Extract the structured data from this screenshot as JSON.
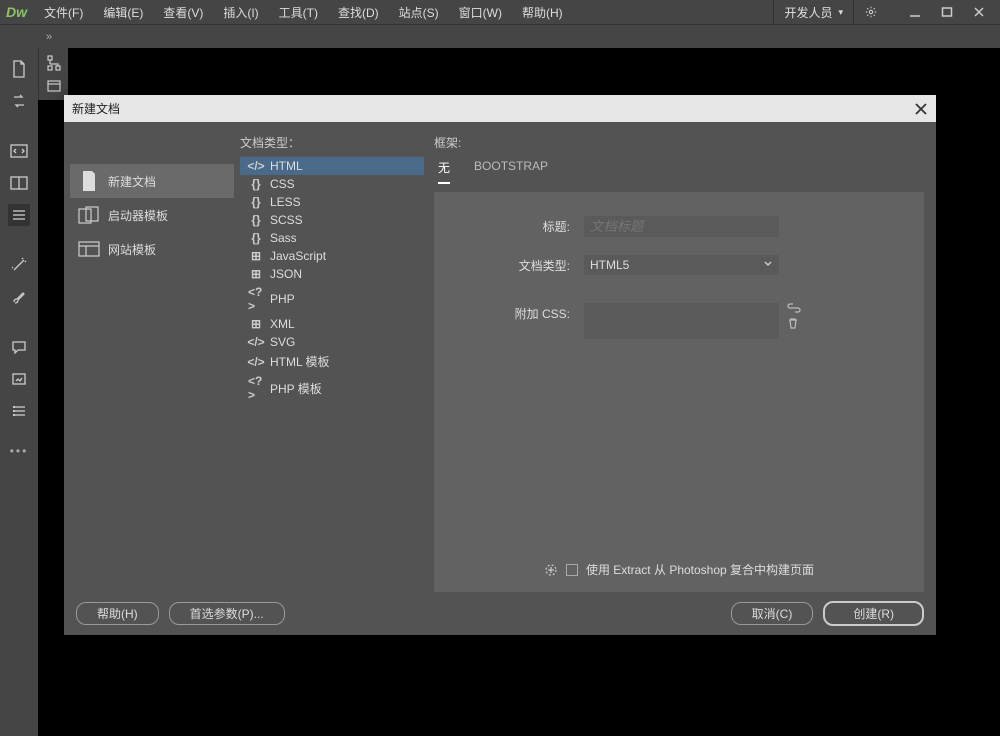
{
  "app": {
    "logo": "Dw"
  },
  "menu": [
    "文件(F)",
    "编辑(E)",
    "查看(V)",
    "插入(I)",
    "工具(T)",
    "查找(D)",
    "站点(S)",
    "窗口(W)",
    "帮助(H)"
  ],
  "workspace": {
    "label": "开发人员",
    "has_dropdown": true
  },
  "tabstrip": {
    "marker": "»"
  },
  "dialog": {
    "title": "新建文档",
    "categories": [
      {
        "icon": "file",
        "label": "新建文档",
        "selected": true
      },
      {
        "icon": "starter",
        "label": "启动器模板",
        "selected": false
      },
      {
        "icon": "sitetpl",
        "label": "网站模板",
        "selected": false
      }
    ],
    "types_header": "文档类型：",
    "types": [
      {
        "icon": "</>",
        "label": "HTML",
        "selected": true
      },
      {
        "icon": "{}",
        "label": "CSS"
      },
      {
        "icon": "{}",
        "label": "LESS"
      },
      {
        "icon": "{}",
        "label": "SCSS"
      },
      {
        "icon": "{}",
        "label": "Sass"
      },
      {
        "icon": "⊞",
        "label": "JavaScript"
      },
      {
        "icon": "⊞",
        "label": "JSON"
      },
      {
        "icon": "<?>",
        "label": "PHP"
      },
      {
        "icon": "⊞",
        "label": "XML"
      },
      {
        "icon": "</>",
        "label": "SVG"
      },
      {
        "icon": "</>",
        "label": "HTML 模板"
      },
      {
        "icon": "<?>",
        "label": "PHP 模板"
      }
    ],
    "frame_header": "框架:",
    "frame_tabs": [
      {
        "label": "无",
        "selected": true
      },
      {
        "label": "BOOTSTRAP",
        "selected": false
      }
    ],
    "form": {
      "title_label": "标题:",
      "title_placeholder": "文档标题",
      "doctype_label": "文档类型:",
      "doctype_value": "HTML5",
      "css_label": "附加 CSS:"
    },
    "extract": {
      "text": "使用 Extract 从 Photoshop 复合中构建页面"
    },
    "footer": {
      "help": "帮助(H)",
      "prefs": "首选参数(P)...",
      "cancel": "取消(C)",
      "create": "创建(R)"
    }
  }
}
